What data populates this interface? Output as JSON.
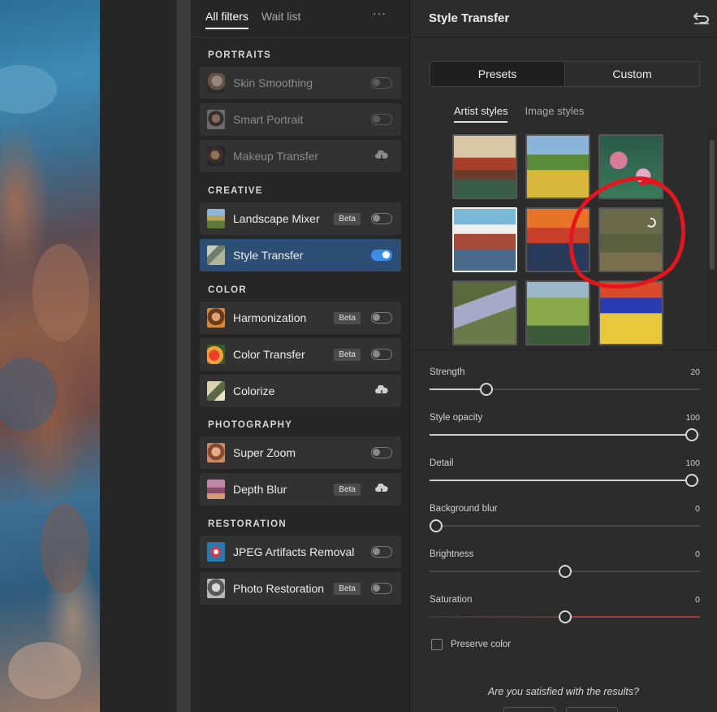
{
  "filters_panel": {
    "tabs": [
      {
        "label": "All filters"
      },
      {
        "label": "Wait list"
      }
    ],
    "more_label": "···",
    "sections": {
      "portraits": "PORTRAITS",
      "creative": "CREATIVE",
      "color": "COLOR",
      "photography": "PHOTOGRAPHY",
      "restoration": "RESTORATION"
    },
    "items": [
      {
        "label": "Skin Smoothing",
        "control": "toggle-off",
        "disabled": true
      },
      {
        "label": "Smart Portrait",
        "control": "toggle-off",
        "disabled": true
      },
      {
        "label": "Makeup Transfer",
        "control": "cloud-download",
        "disabled": true
      },
      {
        "label": "Landscape Mixer",
        "badge": "Beta",
        "control": "toggle-off"
      },
      {
        "label": "Style Transfer",
        "control": "toggle-on",
        "active": true
      },
      {
        "label": "Harmonization",
        "badge": "Beta",
        "control": "toggle-off"
      },
      {
        "label": "Color Transfer",
        "badge": "Beta",
        "control": "toggle-off"
      },
      {
        "label": "Colorize",
        "control": "cloud-download"
      },
      {
        "label": "Super Zoom",
        "control": "toggle-off"
      },
      {
        "label": "Depth Blur",
        "badge": "Beta",
        "control": "cloud-download"
      },
      {
        "label": "JPEG Artifacts Removal",
        "control": "toggle-off"
      },
      {
        "label": "Photo Restoration",
        "badge": "Beta",
        "control": "toggle-off"
      }
    ]
  },
  "style_panel": {
    "title": "Style Transfer",
    "undo_icon": "undo-icon",
    "segments": [
      {
        "label": "Presets",
        "selected": true
      },
      {
        "label": "Custom"
      }
    ],
    "subtabs": [
      {
        "label": "Artist styles",
        "selected": true
      },
      {
        "label": "Image styles"
      }
    ],
    "style_tiles_selected_index": 3,
    "sliders": [
      {
        "label": "Strength",
        "value": "20",
        "fraction": 0.21
      },
      {
        "label": "Style opacity",
        "value": "100",
        "fraction": 0.97
      },
      {
        "label": "Detail",
        "value": "100",
        "fraction": 0.97
      },
      {
        "label": "Background blur",
        "value": "0",
        "fraction": 0.025
      },
      {
        "label": "Brightness",
        "value": "0",
        "fraction": 0.5
      },
      {
        "label": "Saturation",
        "value": "0",
        "fraction": 0.5
      }
    ],
    "preserve_color_label": "Preserve color",
    "feedback_question": "Are you satisfied with the results?"
  },
  "colors": {
    "accent_blue": "#3b8ee6",
    "active_item_bg": "#2d4e74",
    "annotation_red": "#e2161c"
  }
}
